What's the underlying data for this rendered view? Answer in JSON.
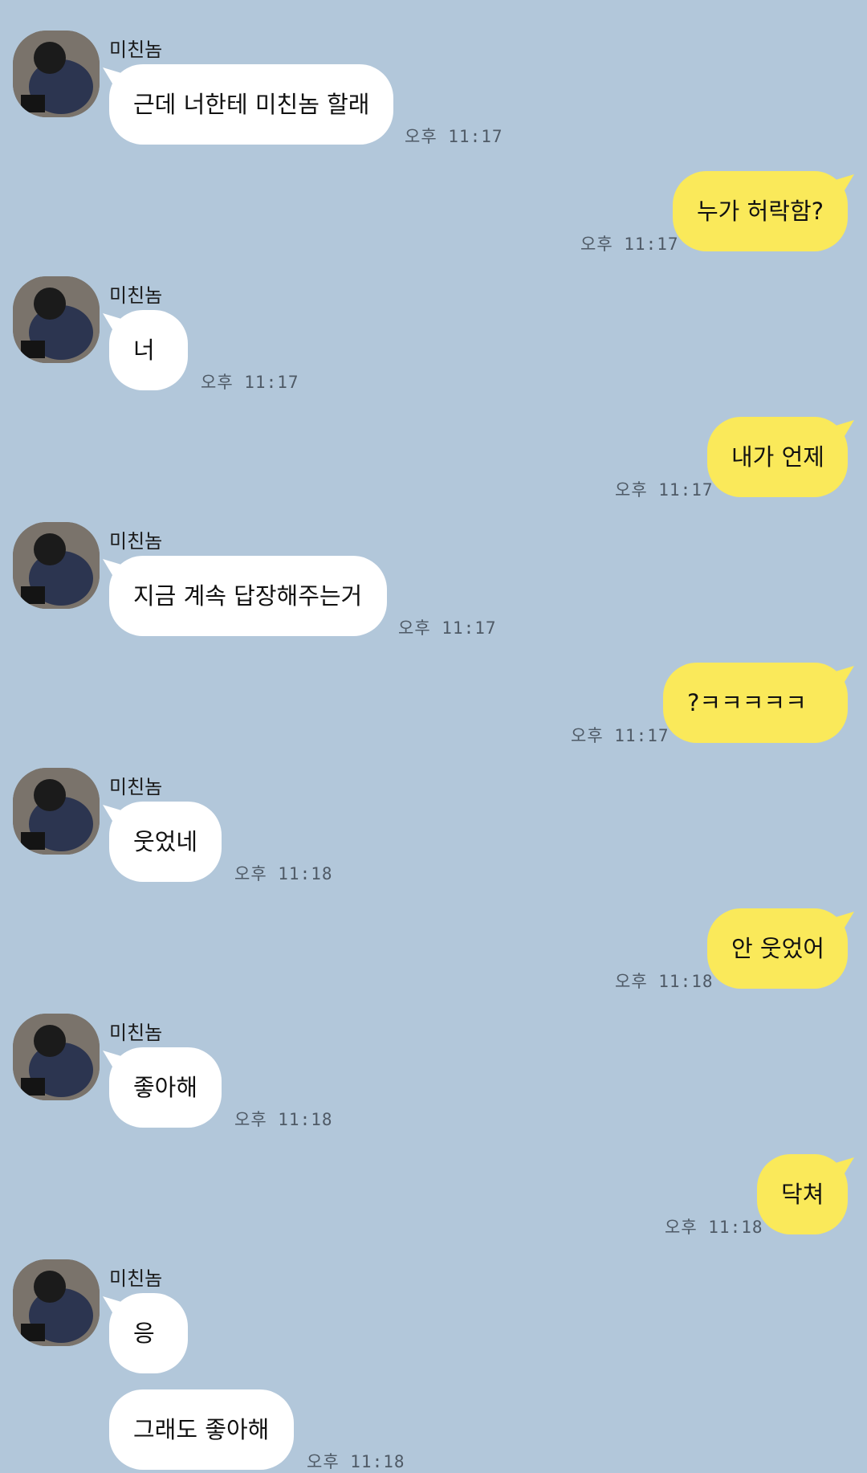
{
  "sender_name": "미친놈",
  "messages": [
    {
      "dir": "in",
      "text": "근데 너한테 미친놈 할래",
      "time": "오후 11:17"
    },
    {
      "dir": "out",
      "text": "누가 허락함?",
      "time": "오후 11:17"
    },
    {
      "dir": "in",
      "text": "너",
      "time": "오후 11:17"
    },
    {
      "dir": "out",
      "text": "내가 언제",
      "time": "오후 11:17"
    },
    {
      "dir": "in",
      "text": "지금 계속 답장해주는거",
      "time": "오후 11:17"
    },
    {
      "dir": "out",
      "text": "?ㅋㅋㅋㅋㅋ",
      "time": "오후 11:17"
    },
    {
      "dir": "in",
      "text": "웃었네",
      "time": "오후 11:18"
    },
    {
      "dir": "out",
      "text": "안 웃었어",
      "time": "오후 11:18"
    },
    {
      "dir": "in",
      "text": "좋아해",
      "time": "오후 11:18"
    },
    {
      "dir": "out",
      "text": "닥쳐",
      "time": "오후 11:18"
    },
    {
      "dir": "in",
      "text": "응",
      "time": ""
    },
    {
      "dir": "in",
      "text": "그래도 좋아해",
      "time": "오후 11:18"
    }
  ],
  "colors": {
    "background": "#b2c7da",
    "incoming_bubble": "#ffffff",
    "outgoing_bubble": "#fae95a"
  }
}
